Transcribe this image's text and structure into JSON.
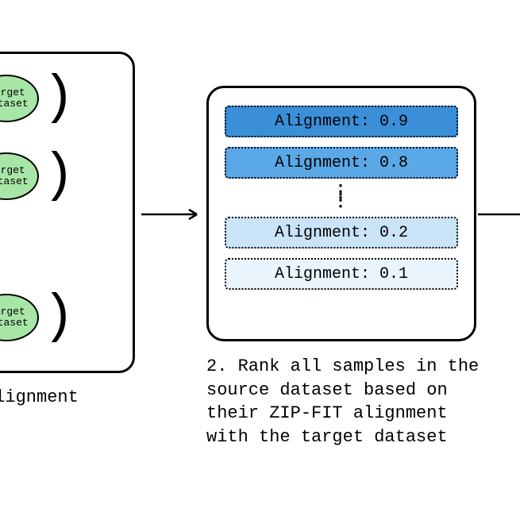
{
  "left": {
    "ellipse_line1": "Target",
    "ellipse_line2": "Dataset",
    "caption": "Alignment"
  },
  "right": {
    "items": [
      {
        "label": "Alignment: 0.9",
        "bg": "#3b8fd9",
        "fg": "#000000"
      },
      {
        "label": "Alignment: 0.8",
        "bg": "#5aa8e6",
        "fg": "#000000"
      },
      {
        "label": "Alignment: 0.2",
        "bg": "#c9e3f7",
        "fg": "#000000"
      },
      {
        "label": "Alignment: 0.1",
        "bg": "#eaf4fc",
        "fg": "#000000"
      }
    ],
    "caption": "2. Rank all samples in the source dataset based on their ZIP-FIT alignment with the target dataset"
  }
}
